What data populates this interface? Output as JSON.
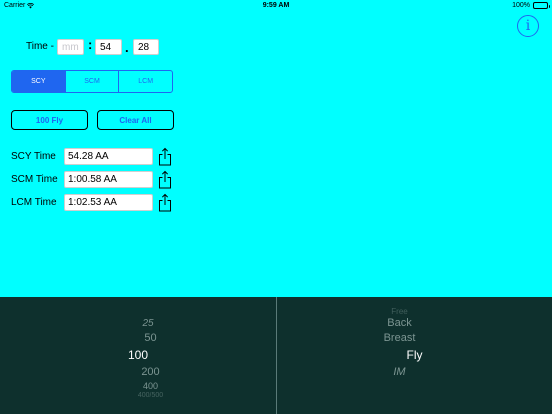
{
  "status_bar": {
    "carrier": "Carrier",
    "time": "9:59 AM",
    "battery_percent": "100%",
    "wifi_icon": "wifi-icon",
    "battery_icon": "battery-icon"
  },
  "header": {
    "info_glyph": "i",
    "info_icon": "info-icon"
  },
  "time_entry": {
    "label": "Time -",
    "minutes_placeholder": "mm",
    "seconds_value": "54",
    "hundredths_value": "28",
    "colon_separator": ":",
    "dot_separator": "."
  },
  "course_selector": {
    "segments": [
      "SCY",
      "SCM",
      "LCM"
    ],
    "selected": "SCY"
  },
  "actions": {
    "event_button_label": "100 Fly",
    "clear_button_label": "Clear All"
  },
  "results": [
    {
      "label": "SCY Time",
      "value": "54.28 AA"
    },
    {
      "label": "SCM Time",
      "value": "1:00.58 AA"
    },
    {
      "label": "LCM Time",
      "value": "1:02.53 AA"
    }
  ],
  "picker": {
    "distances": [
      "25",
      "50",
      "100",
      "200",
      "400",
      "400/500"
    ],
    "selected_distance": "100",
    "strokes": [
      "Free",
      "Back",
      "Breast",
      "Fly",
      "IM"
    ],
    "selected_stroke": "Fly"
  },
  "colors": {
    "background": "#00FFFF",
    "accent": "#1F66F0",
    "picker_background": "#0E302D"
  }
}
